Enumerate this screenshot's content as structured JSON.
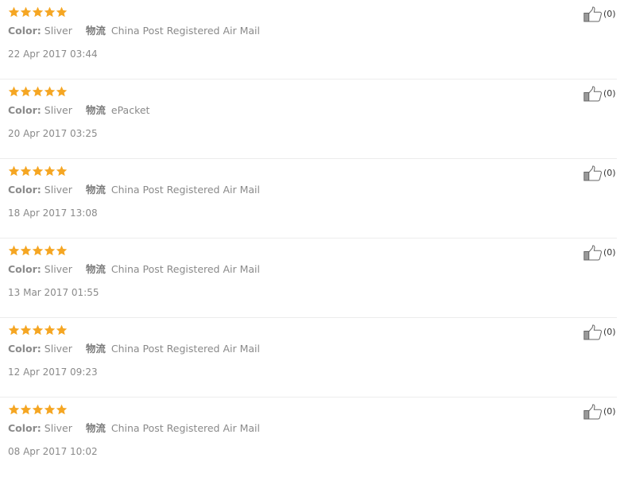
{
  "colors": {
    "star": "#f5a623",
    "text_muted": "#8a8a8a",
    "divider": "#ececec"
  },
  "icons": {
    "rating": "star-icon",
    "helpful": "thumbs-up-icon"
  },
  "reviews": [
    {
      "rating": 5,
      "color_label": "Color:",
      "color_value": "Sliver",
      "ship_label": "物流",
      "ship_value": "China Post Registered Air Mail",
      "date": "22 Apr 2017 03:44",
      "helpful": "(0)"
    },
    {
      "rating": 5,
      "color_label": "Color:",
      "color_value": "Sliver",
      "ship_label": "物流",
      "ship_value": "ePacket",
      "date": "20 Apr 2017 03:25",
      "helpful": "(0)"
    },
    {
      "rating": 5,
      "color_label": "Color:",
      "color_value": "Sliver",
      "ship_label": "物流",
      "ship_value": "China Post Registered Air Mail",
      "date": "18 Apr 2017 13:08",
      "helpful": "(0)"
    },
    {
      "rating": 5,
      "color_label": "Color:",
      "color_value": "Sliver",
      "ship_label": "物流",
      "ship_value": "China Post Registered Air Mail",
      "date": "13 Mar 2017 01:55",
      "helpful": "(0)"
    },
    {
      "rating": 5,
      "color_label": "Color:",
      "color_value": "Sliver",
      "ship_label": "物流",
      "ship_value": "China Post Registered Air Mail",
      "date": "12 Apr 2017 09:23",
      "helpful": "(0)"
    },
    {
      "rating": 5,
      "color_label": "Color:",
      "color_value": "Sliver",
      "ship_label": "物流",
      "ship_value": "China Post Registered Air Mail",
      "date": "08 Apr 2017 10:02",
      "helpful": "(0)"
    }
  ]
}
